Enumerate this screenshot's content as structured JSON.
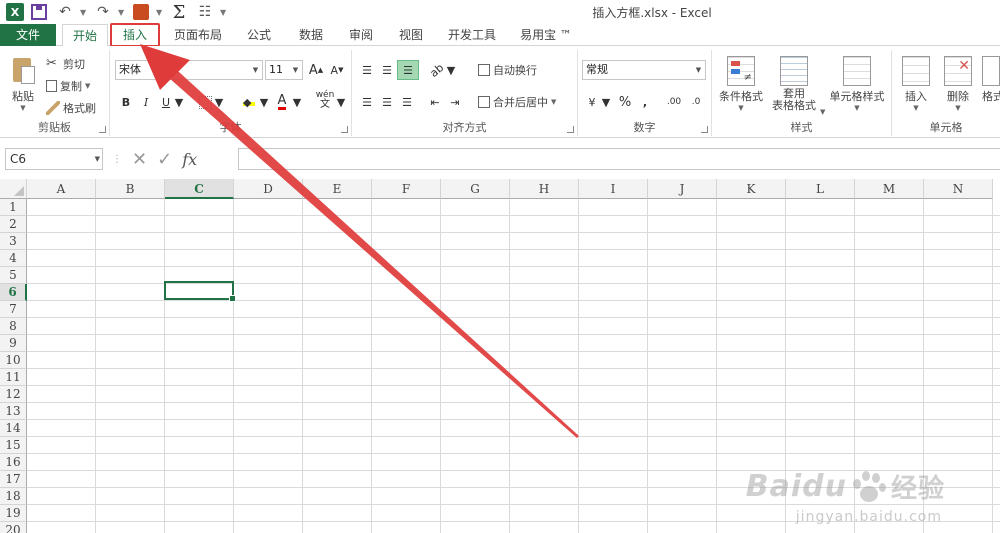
{
  "window": {
    "title": "插入方框.xlsx - Excel"
  },
  "qat": {
    "app_logo": "X"
  },
  "tabs": [
    {
      "label": "文件"
    },
    {
      "label": "开始"
    },
    {
      "label": "插入"
    },
    {
      "label": "页面布局"
    },
    {
      "label": "公式"
    },
    {
      "label": "数据"
    },
    {
      "label": "审阅"
    },
    {
      "label": "视图"
    },
    {
      "label": "开发工具"
    },
    {
      "label": "易用宝 ™"
    }
  ],
  "ribbon": {
    "clipboard": {
      "label": "剪贴板",
      "paste": "粘贴",
      "cut": "剪切",
      "copy": "复制",
      "format_painter": "格式刷"
    },
    "font": {
      "label": "字体",
      "font_name": "宋体",
      "font_size": "11",
      "bold": "B",
      "italic": "I",
      "underline": "U",
      "grow": "A",
      "shrink": "A",
      "font_color_glyph": "A",
      "phonetic": "wén"
    },
    "alignment": {
      "label": "对齐方式",
      "wrap_text": "自动换行",
      "merge_center": "合并后居中"
    },
    "number": {
      "label": "数字",
      "format": "常规",
      "percent": "%",
      "comma": ",",
      "inc_decimal": ".00",
      "dec_decimal": ".0"
    },
    "styles": {
      "label": "样式",
      "conditional": "条件格式",
      "table_format_1": "套用",
      "table_format_2": "表格格式",
      "cell_styles": "单元格样式"
    },
    "cells": {
      "label": "单元格",
      "insert": "插入",
      "delete": "删除",
      "format": "格式"
    }
  },
  "formula_bar": {
    "name_box": "C6",
    "fx": "fx",
    "cancel": "✕",
    "enter": "✓",
    "value": ""
  },
  "sheet": {
    "columns": [
      "A",
      "B",
      "C",
      "D",
      "E",
      "F",
      "G",
      "H",
      "I",
      "J",
      "K",
      "L",
      "M",
      "N"
    ],
    "rows": [
      "1",
      "2",
      "3",
      "4",
      "5",
      "6",
      "7",
      "8",
      "9",
      "10",
      "11",
      "12",
      "13",
      "14",
      "15",
      "16",
      "17",
      "18",
      "19",
      "20"
    ],
    "selected_cell": "C6",
    "selected_column": "C",
    "selected_row": "6"
  },
  "watermark": {
    "brand": "Baidu",
    "brand_cn": "经验",
    "site": "jingyan.baidu.com"
  },
  "colors": {
    "excel_green": "#217346",
    "annotation_red": "#e03b3b"
  }
}
